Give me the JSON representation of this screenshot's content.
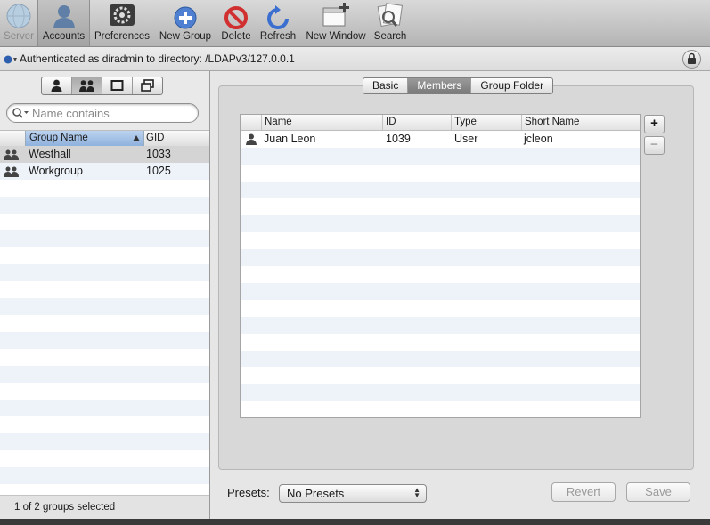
{
  "toolbar": {
    "items": [
      {
        "label": "Server",
        "icon": "globe-icon",
        "disabled": true
      },
      {
        "label": "Accounts",
        "icon": "accounts-icon",
        "selected": true
      },
      {
        "label": "Preferences",
        "icon": "preferences-icon"
      },
      {
        "label": "New Group",
        "icon": "plus-circle-icon"
      },
      {
        "label": "Delete",
        "icon": "delete-icon"
      },
      {
        "label": "Refresh",
        "icon": "refresh-icon"
      },
      {
        "label": "New Window",
        "icon": "new-window-icon"
      },
      {
        "label": "Search",
        "icon": "search-icon"
      }
    ]
  },
  "auth": {
    "text": "Authenticated as diradmin to directory: /LDAPv3/127.0.0.1"
  },
  "sidebar": {
    "search_placeholder": "Name contains",
    "columns": {
      "name": "Group Name",
      "gid": "GID"
    },
    "groups": [
      {
        "name": "Westhall",
        "gid": "1033",
        "selected": true
      },
      {
        "name": "Workgroup",
        "gid": "1025"
      }
    ],
    "status": "1 of 2 groups selected"
  },
  "detail": {
    "tabs": [
      "Basic",
      "Members",
      "Group Folder"
    ],
    "active_tab": "Members",
    "members_table": {
      "columns": [
        "Name",
        "ID",
        "Type",
        "Short Name"
      ],
      "rows": [
        {
          "name": "Juan Leon",
          "id": "1039",
          "type": "User",
          "short_name": "jcleon"
        }
      ]
    },
    "add_label": "+",
    "remove_label": "−",
    "presets_label": "Presets:",
    "presets_value": "No Presets",
    "revert_label": "Revert",
    "save_label": "Save"
  },
  "colors": {
    "selection_header": "#8fb1de",
    "row_stripe": "#eef3fa"
  }
}
